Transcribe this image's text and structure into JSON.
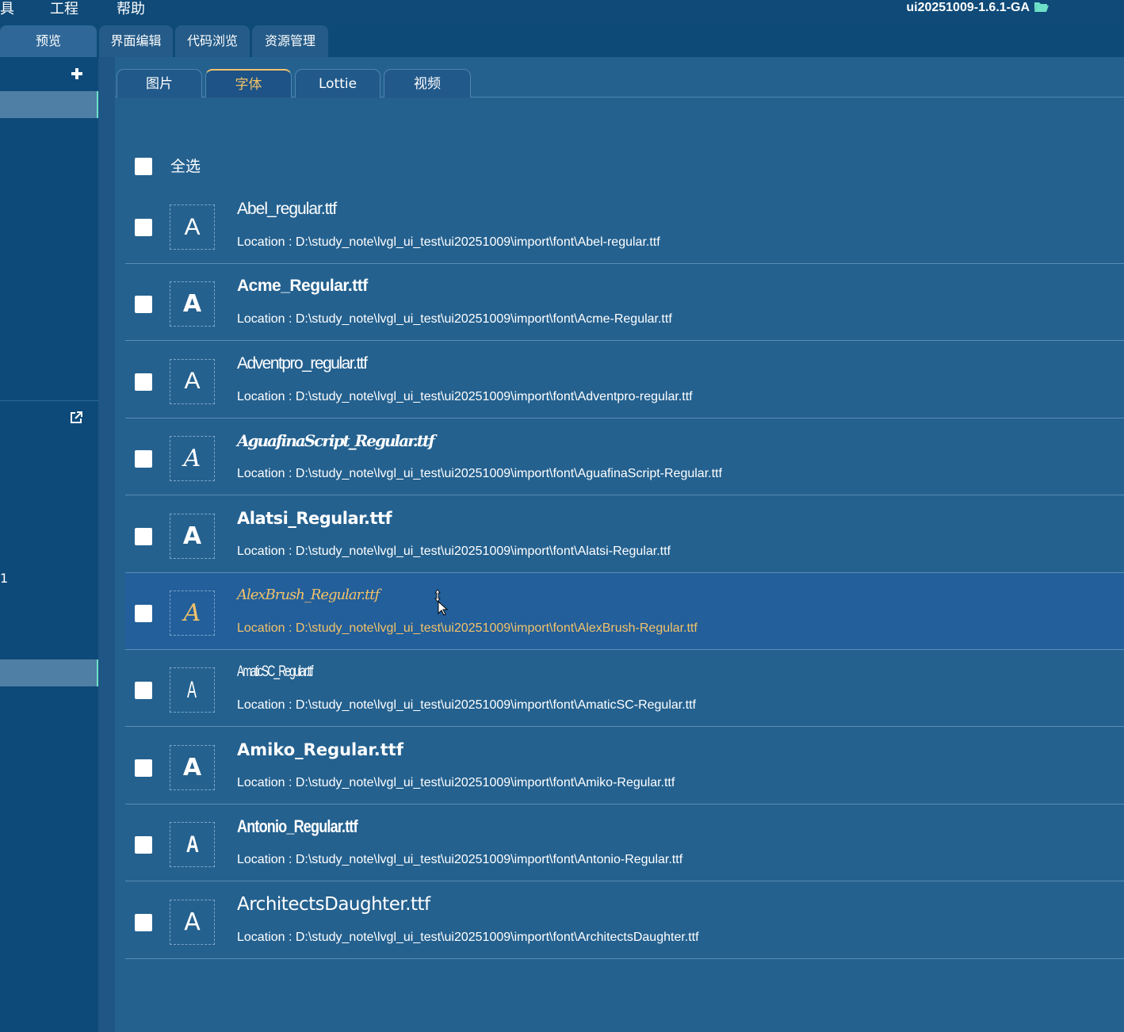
{
  "menubar": {
    "items": [
      "具",
      "工程",
      "帮助"
    ],
    "project_title": "ui20251009-1.6.1-GA",
    "project_icon": "folder-open-icon"
  },
  "main_tabs": [
    {
      "label": "预览",
      "active": true
    },
    {
      "label": "界面编辑",
      "active": false
    },
    {
      "label": "代码浏览",
      "active": false
    },
    {
      "label": "资源管理",
      "active": false
    }
  ],
  "sidebar": {
    "add_icon": "plus-icon",
    "popout_icon": "external-link-icon",
    "partial_text": "1"
  },
  "asset_tabs": [
    {
      "label": "图片",
      "active": false
    },
    {
      "label": "字体",
      "active": true
    },
    {
      "label": "Lottie",
      "active": false
    },
    {
      "label": "视频",
      "active": false
    }
  ],
  "select_all": {
    "label": "全选",
    "checked": false
  },
  "fonts": [
    {
      "name": "Abel_regular.ttf",
      "location": "Location : D:\\study_note\\lvgl_ui_test\\ui20251009\\import\\font\\Abel-regular.ttf",
      "glyph": "A",
      "selected": false
    },
    {
      "name": "Acme_Regular.ttf",
      "location": "Location : D:\\study_note\\lvgl_ui_test\\ui20251009\\import\\font\\Acme-Regular.ttf",
      "glyph": "A",
      "selected": false
    },
    {
      "name": "Adventpro_regular.ttf",
      "location": "Location : D:\\study_note\\lvgl_ui_test\\ui20251009\\import\\font\\Adventpro-regular.ttf",
      "glyph": "A",
      "selected": false
    },
    {
      "name": "AguafinaScript_Regular.ttf",
      "location": "Location : D:\\study_note\\lvgl_ui_test\\ui20251009\\import\\font\\AguafinaScript-Regular.ttf",
      "glyph": "A",
      "selected": false
    },
    {
      "name": "Alatsi_Regular.ttf",
      "location": "Location : D:\\study_note\\lvgl_ui_test\\ui20251009\\import\\font\\Alatsi-Regular.ttf",
      "glyph": "A",
      "selected": false
    },
    {
      "name": "AlexBrush_Regular.ttf",
      "location": "Location : D:\\study_note\\lvgl_ui_test\\ui20251009\\import\\font\\AlexBrush-Regular.ttf",
      "glyph": "A",
      "selected": true
    },
    {
      "name": "AmaticSC_Regular.ttf",
      "location": "Location : D:\\study_note\\lvgl_ui_test\\ui20251009\\import\\font\\AmaticSC-Regular.ttf",
      "glyph": "A",
      "selected": false
    },
    {
      "name": "Amiko_Regular.ttf",
      "location": "Location : D:\\study_note\\lvgl_ui_test\\ui20251009\\import\\font\\Amiko-Regular.ttf",
      "glyph": "A",
      "selected": false
    },
    {
      "name": "Antonio_Regular.ttf",
      "location": "Location : D:\\study_note\\lvgl_ui_test\\ui20251009\\import\\font\\Antonio-Regular.ttf",
      "glyph": "A",
      "selected": false
    },
    {
      "name": "ArchitectsDaughter.ttf",
      "location": "Location : D:\\study_note\\lvgl_ui_test\\ui20251009\\import\\font\\ArchitectsDaughter.ttf",
      "glyph": "A",
      "selected": false
    }
  ],
  "colors": {
    "accent": "#f2c26a",
    "selection_bar": "#6ee0c8",
    "background": "#24618f",
    "sidebar": "#0d4a79"
  }
}
